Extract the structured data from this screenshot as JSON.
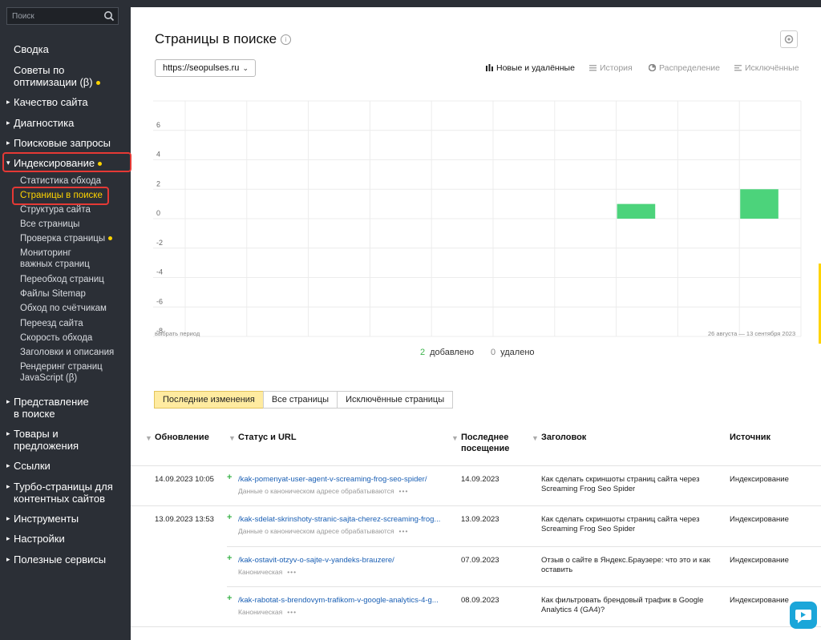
{
  "sidebar": {
    "search_placeholder": "Поиск",
    "sections": [
      {
        "label": "Сводка"
      },
      {
        "label_lines": [
          "Советы по",
          "оптимизации (β)"
        ],
        "dot": true
      },
      {
        "label": "Качество сайта"
      },
      {
        "label": "Диагностика"
      },
      {
        "label": "Поисковые запросы"
      },
      {
        "label": "Индексирование",
        "dot": true
      }
    ],
    "indexing_items": [
      "Статистика обхода",
      "Страницы в поиске",
      "Структура сайта",
      "Все страницы",
      "Проверка страницы",
      "Мониторинг",
      "важных страниц",
      "Переобход страниц",
      "Файлы Sitemap",
      "Обход по счётчикам",
      "Переезд сайта",
      "Скорость обхода",
      "Заголовки и описания",
      "Рендеринг страниц",
      "JavaScript (β)"
    ],
    "lower_sections": [
      [
        "Представление",
        "в поиске"
      ],
      [
        "Товары и",
        "предложения"
      ],
      [
        "Ссылки"
      ],
      [
        "Турбо-страницы для",
        "контентных сайтов"
      ],
      [
        "Инструменты"
      ],
      [
        "Настройки"
      ],
      [
        "Полезные сервисы"
      ]
    ]
  },
  "header": {
    "title": "Страницы в поиске",
    "site": "https://seopulses.ru",
    "views": [
      "Новые и удалённые",
      "История",
      "Распределение",
      "Исключённые"
    ]
  },
  "chart_data": {
    "type": "bar",
    "y_ticks": [
      6,
      4,
      2,
      0,
      -2,
      -4,
      -6,
      -8
    ],
    "ylim": [
      -8,
      8
    ],
    "period_link": "выбрать период",
    "period": "26 августа — 13 сентября 2023",
    "bars": [
      {
        "slot": 7,
        "value": 1
      },
      {
        "slot": 9,
        "value": 2
      }
    ],
    "slots": 10,
    "color": "#4cd37b"
  },
  "summary": {
    "added_count": "2",
    "added_label": "добавлено",
    "removed_count": "0",
    "removed_label": "удалено"
  },
  "tabs": [
    "Последние изменения",
    "Все страницы",
    "Исключённые страницы"
  ],
  "table": {
    "headers": {
      "updated": "Обновление",
      "status": "Статус и URL",
      "last_visit_1": "Последнее",
      "last_visit_2": "посещение",
      "title": "Заголовок",
      "source": "Источник"
    },
    "rows": [
      {
        "date": "14.09.2023 10:05",
        "url": "/kak-pomenyat-user-agent-v-screaming-frog-seo-spider/",
        "status": "Данные о каноническом адресе обрабатываются",
        "visit": "14.09.2023",
        "title1": "Как сделать скриншоты страниц сайта через",
        "title2": "Screaming Frog Seo Spider",
        "source": "Индексирование"
      },
      {
        "date": "13.09.2023 13:53",
        "url": "/kak-sdelat-skrinshoty-stranic-sajta-cherez-screaming-frog...",
        "status": "Данные о каноническом адресе обрабатываются",
        "visit": "13.09.2023",
        "title1": "Как сделать скриншоты страниц сайта через",
        "title2": "Screaming Frog Seo Spider",
        "source": "Индексирование"
      },
      {
        "date": "",
        "url": "/kak-ostavit-otzyv-o-sajte-v-yandeks-brauzere/",
        "status": "Каноническая",
        "visit": "07.09.2023",
        "title1": "Отзыв о сайте в Яндекс.Браузере: что это и как",
        "title2": "оставить",
        "source": "Индексирование"
      },
      {
        "date": "",
        "url": "/kak-rabotat-s-brendovym-trafikom-v-google-analytics-4-g...",
        "status": "Каноническая",
        "visit": "08.09.2023",
        "title1": "Как фильтровать брендовый трафик в Google",
        "title2": "Analytics 4 (GA4)?",
        "source": "Индексирование"
      }
    ]
  },
  "colors": {
    "accent": "#ffd400",
    "sidebar_bg": "#2b2f36",
    "bar": "#4cd37b",
    "link": "#1a5fb4",
    "highlight": "#e53935"
  }
}
